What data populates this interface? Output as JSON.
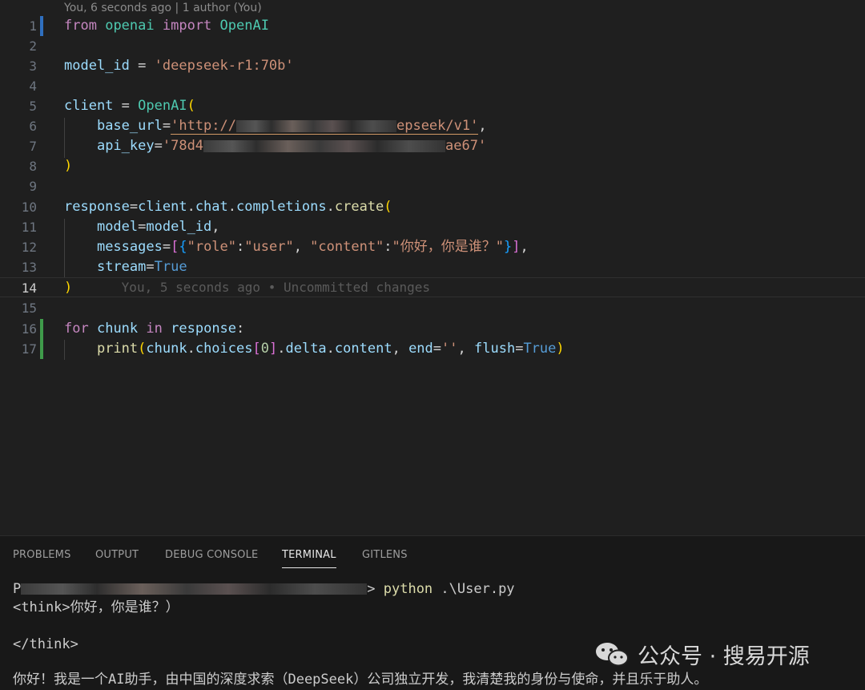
{
  "editor": {
    "codelens": "You, 6 seconds ago | 1 author (You)",
    "blame_ghost": "You, 5 seconds ago • Uncommitted changes",
    "line_numbers": [
      "1",
      "2",
      "3",
      "4",
      "5",
      "6",
      "7",
      "8",
      "9",
      "10",
      "11",
      "12",
      "13",
      "14",
      "15",
      "16",
      "17"
    ],
    "code": {
      "l1": [
        "from",
        "openai",
        "import",
        "OpenAI"
      ],
      "l3": [
        "model_id",
        "=",
        "'deepseek-r1:70b'"
      ],
      "l5": [
        "client",
        "=",
        "OpenAI",
        "("
      ],
      "l6": [
        "base_url",
        "=",
        "'http://",
        "epseek/v1'",
        ","
      ],
      "l7": [
        "api_key",
        "=",
        "'78d4",
        "ae67'"
      ],
      "l8": [
        ")"
      ],
      "l10": [
        "response",
        "=",
        "client",
        ".",
        "chat",
        ".",
        "completions",
        ".",
        "create",
        "("
      ],
      "l11": [
        "model",
        "=",
        "model_id",
        ","
      ],
      "l12": [
        "messages",
        "=",
        "[",
        "{",
        "\"role\"",
        ":",
        "\"user\"",
        ", ",
        "\"content\"",
        ":",
        "\"你好，你是谁？\"",
        "}",
        "]",
        ","
      ],
      "l13": [
        "stream",
        "=",
        "True"
      ],
      "l14": [
        ")"
      ],
      "l16": [
        "for",
        "chunk",
        "in",
        "response",
        ":"
      ],
      "l17": [
        "print",
        "(",
        "chunk",
        ".",
        "choices",
        "[",
        "0",
        "]",
        ".",
        "delta",
        ".",
        "content",
        ", ",
        "end",
        "=",
        "''",
        ", ",
        "flush",
        "=",
        "True",
        ")"
      ]
    }
  },
  "panel": {
    "tabs": [
      "PROBLEMS",
      "OUTPUT",
      "DEBUG CONSOLE",
      "TERMINAL",
      "GITLENS"
    ],
    "active_tab": "TERMINAL",
    "terminal": {
      "prompt_prefix": "P",
      "prompt_suffix": ">",
      "command": "python",
      "command_arg": ".\\User.py",
      "line2": "<think>你好，你是谁？）",
      "line3": "</think>",
      "line4": "你好！我是一个AI助手，由中国的深度求索（DeepSeek）公司独立开发，我清楚我的身份与使命，并且乐于助人。"
    }
  },
  "watermark": {
    "text": "公众号 · 搜易开源",
    "icon": "wechat-icon"
  },
  "colors": {
    "background": "#1f1f1f",
    "keyword": "#c586c0",
    "string": "#ce9178",
    "function": "#dcdcaa",
    "variable": "#9cdcfe",
    "class": "#4ec9b0"
  }
}
